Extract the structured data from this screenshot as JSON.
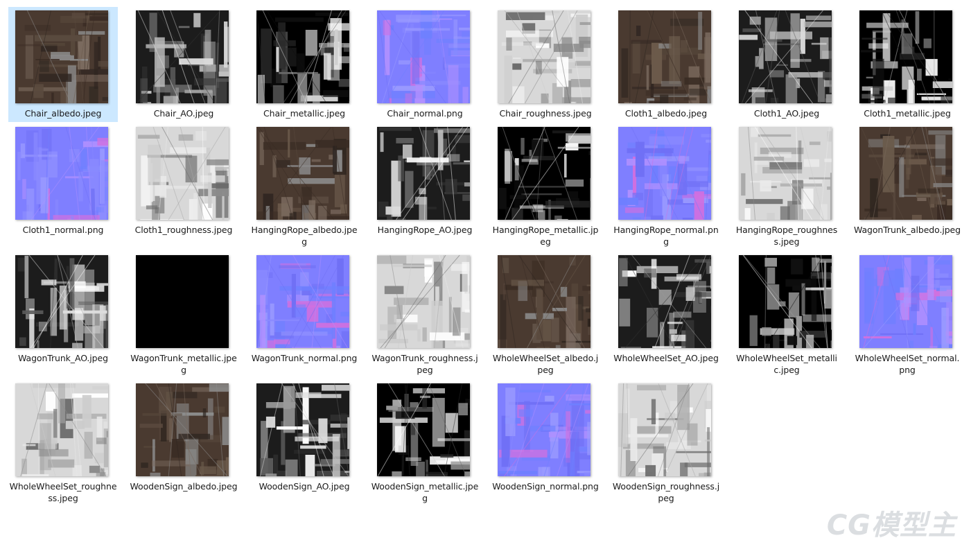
{
  "files": [
    {
      "name": "Chair_albedo.jpeg",
      "selected": true,
      "kind": "albedo"
    },
    {
      "name": "Chair_AO.jpeg",
      "kind": "ao"
    },
    {
      "name": "Chair_metallic.jpeg",
      "kind": "metallic"
    },
    {
      "name": "Chair_normal.png",
      "kind": "normal"
    },
    {
      "name": "Chair_roughness.jpeg",
      "kind": "roughness"
    },
    {
      "name": "Cloth1_albedo.jpeg",
      "kind": "albedo"
    },
    {
      "name": "Cloth1_AO.jpeg",
      "kind": "ao"
    },
    {
      "name": "Cloth1_metallic.jpeg",
      "kind": "metallic"
    },
    {
      "name": "Cloth1_normal.png",
      "kind": "normal"
    },
    {
      "name": "Cloth1_roughness.jpeg",
      "kind": "roughness"
    },
    {
      "name": "HangingRope_albedo.jpeg",
      "kind": "albedo"
    },
    {
      "name": "HangingRope_AO.jpeg",
      "kind": "ao"
    },
    {
      "name": "HangingRope_metallic.jpeg",
      "kind": "metallic"
    },
    {
      "name": "HangingRope_normal.png",
      "kind": "normal"
    },
    {
      "name": "HangingRope_roughness.jpeg",
      "kind": "roughness"
    },
    {
      "name": "WagonTrunk_albedo.jpeg",
      "kind": "albedo"
    },
    {
      "name": "WagonTrunk_AO.jpeg",
      "kind": "ao"
    },
    {
      "name": "WagonTrunk_metallic.jpeg",
      "kind": "black"
    },
    {
      "name": "WagonTrunk_normal.png",
      "kind": "normal"
    },
    {
      "name": "WagonTrunk_roughness.jpeg",
      "kind": "roughness"
    },
    {
      "name": "WholeWheelSet_albedo.jpeg",
      "kind": "albedo"
    },
    {
      "name": "WholeWheelSet_AO.jpeg",
      "kind": "ao"
    },
    {
      "name": "WholeWheelSet_metallic.jpeg",
      "kind": "metallic"
    },
    {
      "name": "WholeWheelSet_normal.png",
      "kind": "normal"
    },
    {
      "name": "WholeWheelSet_roughness.jpeg",
      "kind": "roughness"
    },
    {
      "name": "WoodenSign_albedo.jpeg",
      "kind": "albedo"
    },
    {
      "name": "WoodenSign_AO.jpeg",
      "kind": "ao"
    },
    {
      "name": "WoodenSign_metallic.jpeg",
      "kind": "metallic"
    },
    {
      "name": "WoodenSign_normal.png",
      "kind": "normal"
    },
    {
      "name": "WoodenSign_roughness.jpeg",
      "kind": "roughness"
    }
  ],
  "watermark": "CG模型主",
  "colors": {
    "selection": "#cce8ff",
    "normal_map": "#7f7fff",
    "albedo": "#4a3a30",
    "ao": "#1c1c1c",
    "metallic": "#000000",
    "roughness": "#d8d8d8"
  }
}
